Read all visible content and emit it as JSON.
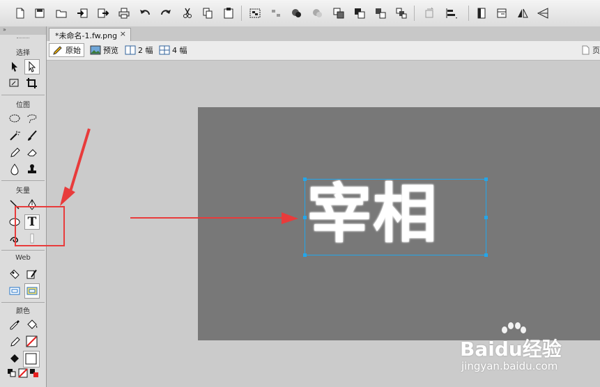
{
  "toolbar": {
    "buttons": [
      "new-icon",
      "save-icon",
      "open-icon",
      "import-icon",
      "export-icon",
      "print-icon",
      "undo-icon",
      "redo-icon",
      "cut-icon",
      "copy-icon",
      "paste-icon",
      "group-icon",
      "ungroup-icon",
      "join-icon",
      "split-icon",
      "bring-forward-icon",
      "bring-to-front-icon",
      "send-backward-icon",
      "send-to-back-icon",
      "rotate-icon",
      "align-icon",
      "flip-horizontal-page-icon",
      "flip-page-icon",
      "flip-horizontal-icon",
      "flip-vertical-icon"
    ]
  },
  "tools": {
    "collapse_glyph": "»",
    "sections": {
      "select": "选择",
      "bitmap": "位图",
      "vector": "矢量",
      "web": "Web",
      "color": "颜色"
    },
    "text_tool_letter": "T"
  },
  "document": {
    "tab_label": "*未命名-1.fw.png",
    "close_glyph": "×"
  },
  "view": {
    "original": "原始",
    "preview": "预览",
    "two_up": "2 幅",
    "four_up": "4 幅",
    "page": "页"
  },
  "canvas": {
    "text": "宰相",
    "colors": {
      "canvas_bg": "#787878",
      "selection": "#23a6ea",
      "annotation": "#e83b3b"
    }
  },
  "watermark": {
    "line1": "Baidu经验",
    "line2": "jingyan.baidu.com"
  }
}
